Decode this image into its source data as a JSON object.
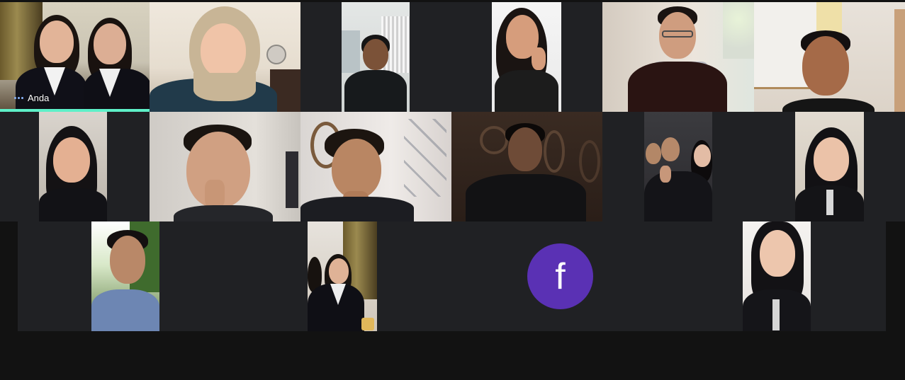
{
  "meeting": {
    "self_label": "Anda",
    "accent": "#5ef0c8",
    "background": "#121212",
    "tile_background": "#202124"
  },
  "participants": [
    {
      "id": "self",
      "label": "Anda",
      "speaking": true,
      "video": true
    },
    {
      "id": "p2",
      "video": true
    },
    {
      "id": "p3",
      "video": true
    },
    {
      "id": "p4",
      "video": true
    },
    {
      "id": "p5",
      "video": true
    },
    {
      "id": "p6",
      "video": true
    },
    {
      "id": "p7",
      "video": true
    },
    {
      "id": "p8",
      "video": true
    },
    {
      "id": "p9",
      "video": true
    },
    {
      "id": "p10",
      "video": true
    },
    {
      "id": "p11",
      "video": true
    },
    {
      "id": "p12",
      "video": true
    },
    {
      "id": "p13",
      "video": true
    },
    {
      "id": "p14",
      "video": true
    },
    {
      "id": "p15",
      "video": false,
      "avatar_letter": "f",
      "avatar_color": "#5a31b4"
    },
    {
      "id": "p16",
      "video": true
    }
  ]
}
